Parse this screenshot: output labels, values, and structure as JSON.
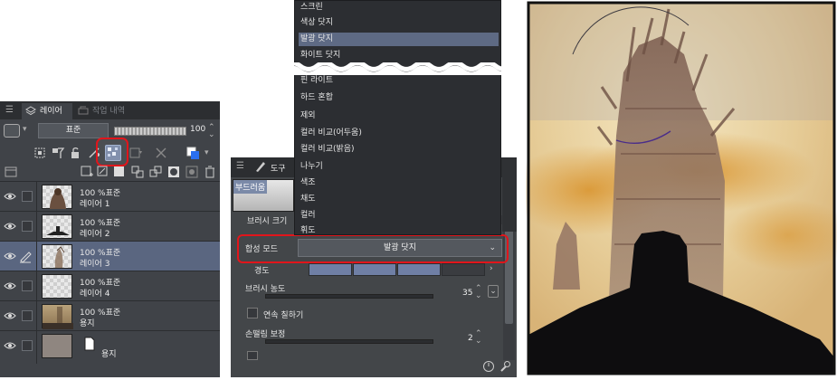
{
  "layer_panel": {
    "tabs": [
      {
        "label": "레이어",
        "icon": "layers-icon"
      },
      {
        "label": "작업 내역",
        "icon": "history-icon"
      }
    ],
    "blend_mode": "표준",
    "opacity": "100",
    "opacity_fraction": 1.0,
    "layers": [
      {
        "percent_mode": "100 %표준",
        "name": "레이어 1",
        "visible": true,
        "selected": false,
        "thumb": "figure"
      },
      {
        "percent_mode": "100 %표준",
        "name": "레이어 2",
        "visible": true,
        "selected": false,
        "thumb": "shadow"
      },
      {
        "percent_mode": "100 %표준",
        "name": "레이어 3",
        "visible": true,
        "selected": true,
        "thumb": "sketch"
      },
      {
        "percent_mode": "100 %표준",
        "name": "레이어 4",
        "visible": true,
        "selected": false,
        "thumb": "empty"
      },
      {
        "percent_mode": "100 %표준",
        "name": "용지",
        "visible": true,
        "selected": false,
        "thumb": "paper"
      },
      {
        "percent_mode": "",
        "name": "용지",
        "visible": true,
        "selected": false,
        "thumb": "paper-color"
      }
    ]
  },
  "brush_panel": {
    "tab_label": "도구",
    "preset_label": "부드러움",
    "brush_size_label": "브러시 크기",
    "blend_label": "합성 모드",
    "blend_value": "발광 닷지",
    "hardness_label": "경도",
    "density_label": "브러시 농도",
    "density_value": "35",
    "continuous_label": "연속 칠하기",
    "stabilize_label": "손떨림 보정",
    "stabilize_value": "2"
  },
  "dropdown": {
    "items_top": [
      "스크린",
      "색상 닷지",
      "발광 닷지",
      "화이트 닷지"
    ],
    "items_bottom": [
      "핀 라이트",
      "하드 혼합",
      "제외",
      "컬러 비교(어두움)",
      "컬러 비교(밝음)",
      "나누기",
      "색조",
      "채도",
      "컬러",
      "휘도"
    ],
    "selected": "발광 닷지"
  },
  "colors": {
    "panel_bg": "#404348",
    "selected_row": "#5a6680",
    "highlight": "#e1151b"
  }
}
